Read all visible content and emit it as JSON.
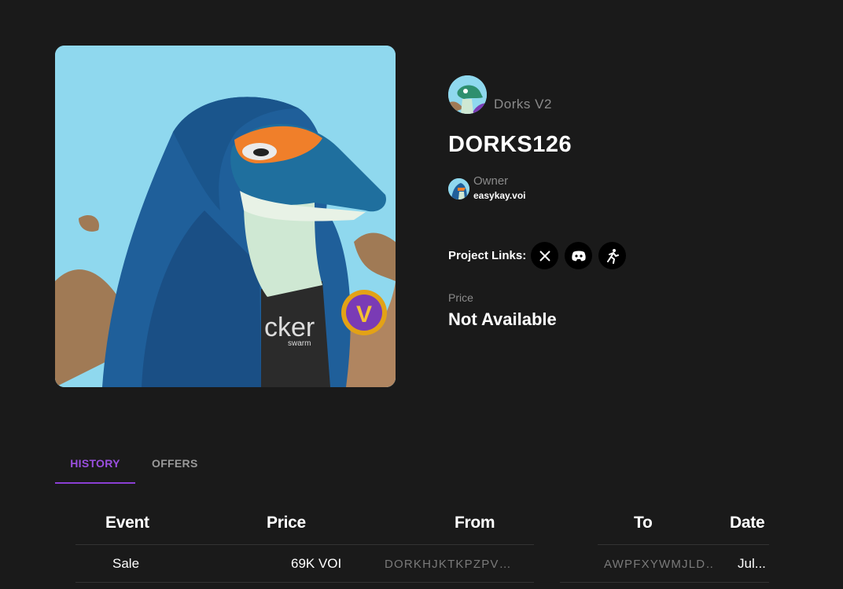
{
  "nft": {
    "collection": "Dorks V2",
    "title": "DORKS126",
    "owner_label": "Owner",
    "owner_name": "easykay.voi",
    "links_label": "Project Links:",
    "links": [
      "x-icon",
      "discord-icon",
      "nautilus-icon"
    ],
    "price_label": "Price",
    "price_value": "Not Available",
    "art_badge": "V",
    "art_shirt_text": "cker",
    "art_shirt_sub": "swarm"
  },
  "tabs": [
    "HISTORY",
    "OFFERS"
  ],
  "active_tab": "HISTORY",
  "table": {
    "headers": [
      "Event",
      "Price",
      "From",
      "To",
      "Date"
    ],
    "rows": [
      {
        "event": "Sale",
        "price": "69K VOI",
        "from": "DORKHJKTKPZPV…",
        "to": "AWPFXYWMJLD…",
        "date": "Jul..."
      }
    ]
  },
  "colors": {
    "background": "#1a1a1a",
    "accent": "#9b4fe0",
    "muted": "#8b8b8b"
  }
}
